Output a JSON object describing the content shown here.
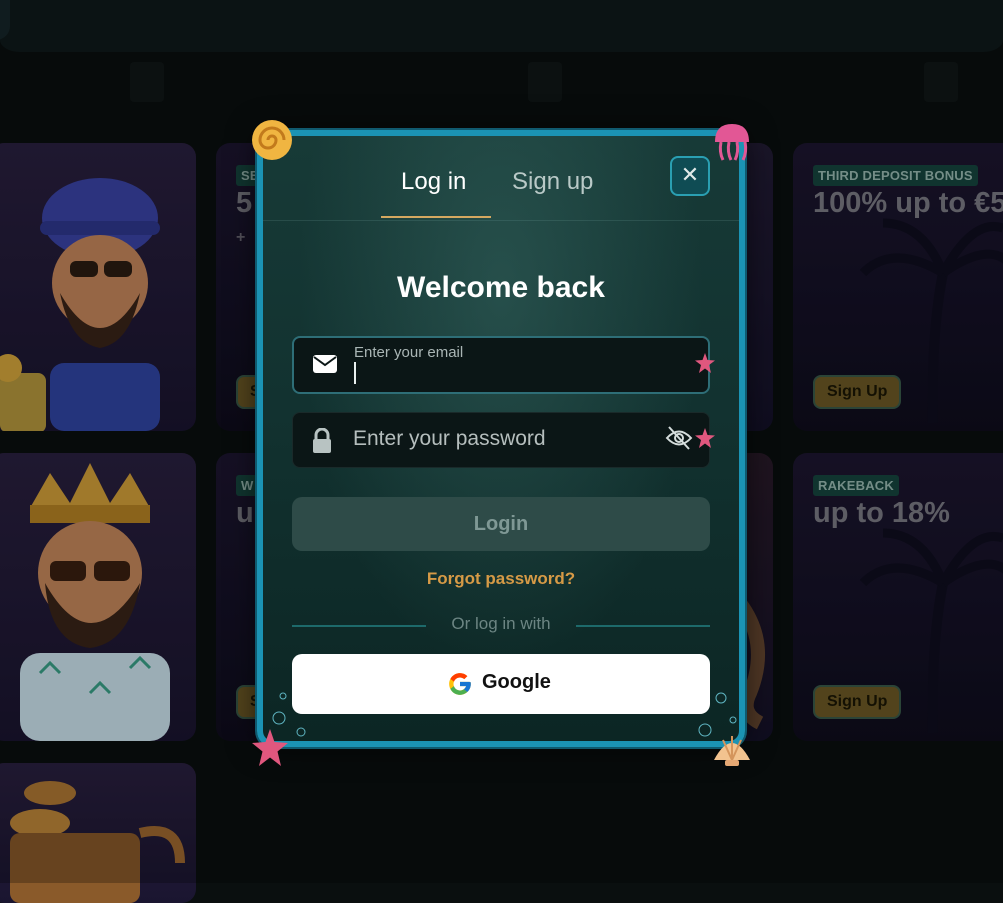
{
  "background": {
    "cards": [
      {
        "badge": "SE",
        "headline": "5",
        "headline_sub": "+",
        "button": "S"
      },
      {
        "badge": "THIRD DEPOSIT BONUS",
        "headline": "100% up to €5",
        "button": "Sign Up"
      },
      {
        "badge": "W",
        "headline": "u",
        "button": "S"
      },
      {
        "badge": "RAKEBACK",
        "headline": "up to 18%",
        "button": "Sign Up"
      }
    ]
  },
  "modal": {
    "tabs": [
      {
        "label": "Log in",
        "active": true
      },
      {
        "label": "Sign up",
        "active": false
      }
    ],
    "close_icon": "close-icon",
    "title": "Welcome back",
    "email": {
      "label": "Enter your email",
      "value": "",
      "icon": "mail-icon"
    },
    "password": {
      "placeholder": "Enter your password",
      "icon": "lock-icon",
      "toggle_icon": "eye-off-icon"
    },
    "login_button": "Login",
    "forgot_link": "Forgot password?",
    "divider_text": "Or log in with",
    "google_button": "Google"
  },
  "colors": {
    "modal_border": "#1b93b4",
    "accent_gold": "#d69a46",
    "login_disabled_bg": "#2e4b48"
  }
}
